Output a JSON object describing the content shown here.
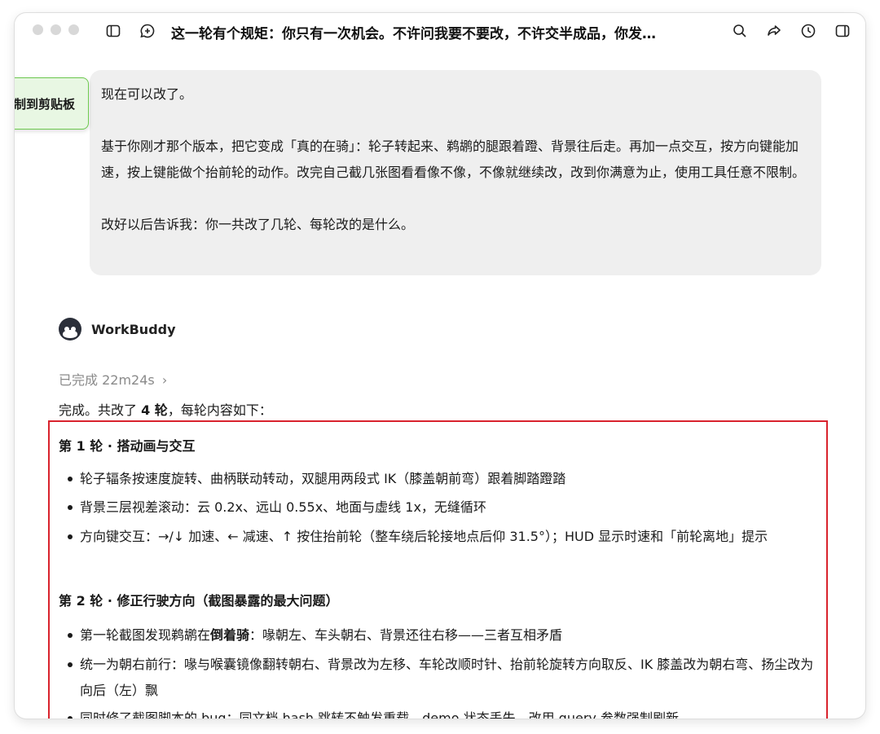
{
  "window": {
    "title": "这一轮有个规矩：你只有一次机会。不许问我要不要改，不许交半成品，你发…",
    "toolbar_icons": [
      "sidebar-toggle-icon",
      "new-chat-icon",
      "search-icon",
      "share-icon",
      "history-icon",
      "panel-icon"
    ]
  },
  "toast": {
    "text": "制到剪贴板"
  },
  "user_message": {
    "paragraphs": [
      "现在可以改了。",
      "基于你刚才那个版本，把它变成「真的在骑」：轮子转起来、鹈鹕的腿跟着蹬、背景往后走。再加一点交互，按方向键能加速，按上键能做个抬前轮的动作。改完自己截几张图看看像不像，不像就继续改，改到你满意为止，使用工具任意不限制。",
      "改好以后告诉我：你一共改了几轮、每轮改的是什么。"
    ]
  },
  "assistant": {
    "name": "WorkBuddy",
    "status": "已完成 22m24s",
    "status_chevron": "›",
    "intro": {
      "prefix": "完成。共改了 ",
      "bold": "4 轮",
      "suffix": "，每轮内容如下："
    },
    "rounds": [
      {
        "heading": "第 1 轮 · 搭动画与交互",
        "items": [
          "轮子辐条按速度旋转、曲柄联动转动，双腿用两段式 IK（膝盖朝前弯）跟着脚踏蹬踏",
          "背景三层视差滚动：云 0.2x、远山 0.55x、地面与虚线 1x，无缝循环",
          "方向键交互：→/↓ 加速、← 减速、↑ 按住抬前轮（整车绕后轮接地点后仰 31.5°）；HUD 显示时速和「前轮离地」提示"
        ]
      },
      {
        "heading": "第 2 轮 · 修正行驶方向（截图暴露的最大问题）",
        "items": [
          {
            "prefix": "第一轮截图发现鹈鹕在",
            "bold": "倒着骑",
            "suffix": "：喙朝左、车头朝右、背景还往右移——三者互相矛盾"
          },
          "统一为朝右前行：喙与喉囊镜像翻转朝右、背景改为左移、车轮改顺时针、抬前轮旋转方向取反、IK 膝盖改为朝右弯、扬尘改为向后（左）飘",
          "同时修了截图脚本的 bug：同文档 hash 跳转不触发重载，demo 状态丢失，改用 query 参数强制刷新"
        ]
      }
    ]
  },
  "colors": {
    "highlight_border": "#d9232d",
    "toast_border": "#6cc94e",
    "bubble_bg": "#efefef"
  }
}
